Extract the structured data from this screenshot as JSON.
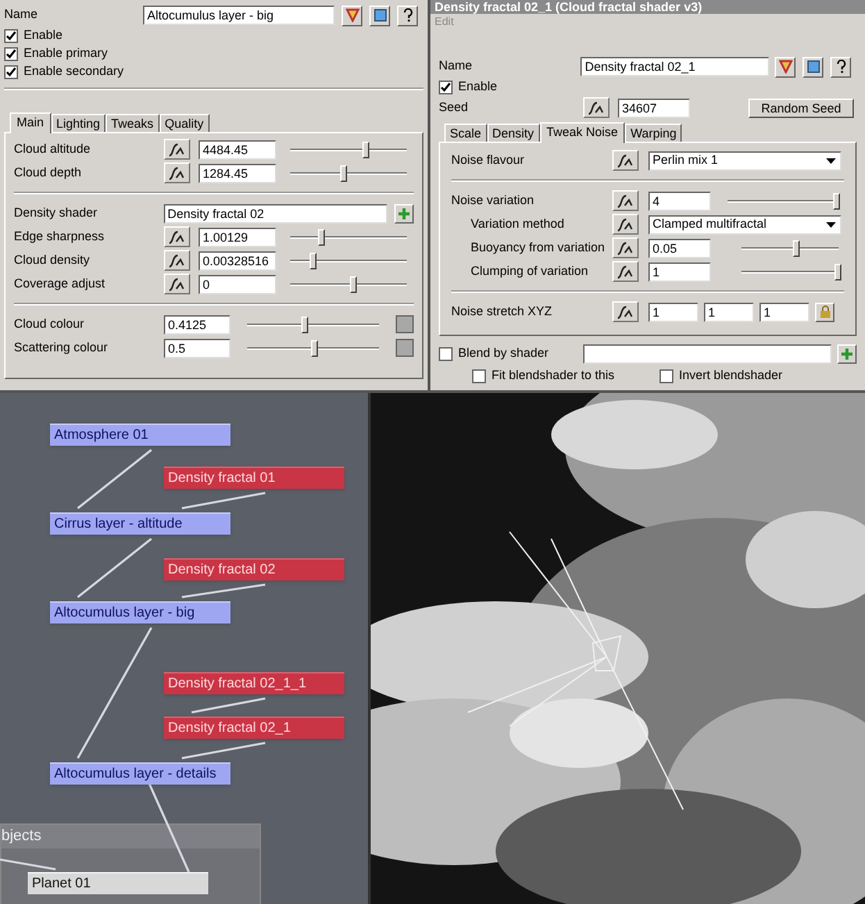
{
  "layer_panel": {
    "name_label": "Name",
    "name_value": "Altocumulus layer - big",
    "checkboxes": [
      {
        "label": "Enable",
        "checked": true
      },
      {
        "label": "Enable primary",
        "checked": true
      },
      {
        "label": "Enable secondary",
        "checked": true
      }
    ],
    "tabs": [
      {
        "label": "Main",
        "selected": true
      },
      {
        "label": "Lighting",
        "selected": false
      },
      {
        "label": "Tweaks",
        "selected": false
      },
      {
        "label": "Quality",
        "selected": false
      }
    ],
    "groups": [
      [
        {
          "kind": "slider",
          "label": "Cloud altitude",
          "value": "4484.45",
          "level": 0.64
        },
        {
          "kind": "slider",
          "label": "Cloud depth",
          "value": "1284.45",
          "level": 0.45
        }
      ],
      [
        {
          "kind": "shader",
          "label": "Density shader",
          "value": "Density fractal 02"
        },
        {
          "kind": "slider",
          "label": "Edge sharpness",
          "value": "1.00129",
          "level": 0.26
        },
        {
          "kind": "slider",
          "label": "Cloud density",
          "value": "0.00328516",
          "level": 0.19
        },
        {
          "kind": "slider",
          "label": "Coverage adjust",
          "value": "0",
          "level": 0.53
        }
      ],
      [
        {
          "kind": "colour",
          "label": "Cloud colour",
          "value": "0.4125",
          "level": 0.43
        },
        {
          "kind": "colour",
          "label": "Scattering colour",
          "value": "0.5",
          "level": 0.51
        }
      ]
    ]
  },
  "shader_panel": {
    "title": "Density fractal 02_1   (Cloud fractal shader v3)",
    "menu": [
      "Edit"
    ],
    "name_label": "Name",
    "name_value": "Density fractal 02_1",
    "enable": {
      "label": "Enable",
      "checked": true
    },
    "seed_label": "Seed",
    "seed_value": "34607",
    "random_button": "Random Seed",
    "tabs": [
      {
        "label": "Scale",
        "selected": false
      },
      {
        "label": "Density",
        "selected": false
      },
      {
        "label": "Tweak Noise",
        "selected": true
      },
      {
        "label": "Warping",
        "selected": false
      }
    ],
    "groups": [
      [
        {
          "kind": "dropdown",
          "label": "Noise flavour",
          "value": "Perlin mix 1"
        }
      ],
      [
        {
          "kind": "slider",
          "label": "Noise variation",
          "value": "4",
          "level": 0.98,
          "children": [
            {
              "kind": "dropdown",
              "label": "Variation method",
              "value": "Clamped multifractal"
            },
            {
              "kind": "slider",
              "label": "Buoyancy from variation",
              "value": "0.05",
              "level": 0.55
            },
            {
              "kind": "slider",
              "label": "Clumping of variation",
              "value": "1",
              "level": 0.98
            }
          ]
        }
      ],
      [
        {
          "kind": "xyz",
          "label": "Noise stretch XYZ",
          "values": [
            "1",
            "1",
            "1"
          ]
        }
      ]
    ],
    "blend": {
      "label": "Blend by shader",
      "checked": false
    },
    "options": [
      {
        "label": "Fit blendshader to this",
        "checked": false
      },
      {
        "label": "Invert blendshader",
        "checked": false
      }
    ]
  },
  "node_graph": {
    "nodes": [
      {
        "kind": "layer",
        "label": "Atmosphere 01"
      },
      {
        "kind": "shader",
        "label": "Density fractal 01"
      },
      {
        "kind": "layer",
        "label": "Cirrus layer - altitude"
      },
      {
        "kind": "shader",
        "label": "Density fractal 02"
      },
      {
        "kind": "layer",
        "label": "Altocumulus layer - big"
      },
      {
        "kind": "shader",
        "label": "Density fractal 02_1_1"
      },
      {
        "kind": "shader",
        "label": "Density fractal 02_1"
      },
      {
        "kind": "layer",
        "label": "Altocumulus layer - details"
      }
    ],
    "objects_group": {
      "title": "bjects",
      "nodes": [
        {
          "kind": "object",
          "label": "Planet 01"
        }
      ]
    }
  }
}
